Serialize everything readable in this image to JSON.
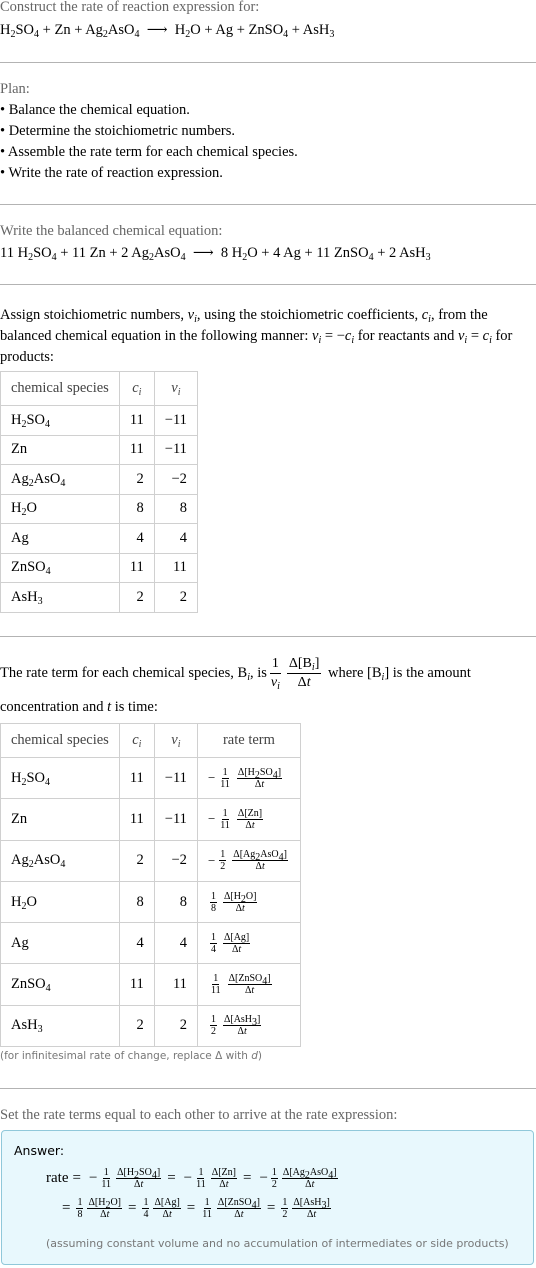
{
  "intro": {
    "prompt": "Construct the rate of reaction expression for:",
    "reaction": {
      "reactants": [
        "H2SO4",
        "Zn",
        "Ag2AsO4"
      ],
      "products": [
        "H2O",
        "Ag",
        "ZnSO4",
        "AsH3"
      ]
    }
  },
  "plan": {
    "title": "Plan:",
    "steps": [
      "• Balance the chemical equation.",
      "• Determine the stoichiometric numbers.",
      "• Assemble the rate term for each chemical species.",
      "• Write the rate of reaction expression."
    ]
  },
  "balanced": {
    "title": "Write the balanced chemical equation:",
    "equation": "11 H2SO4 + 11 Zn + 2 Ag2AsO4 ⟶ 8 H2O + 4 Ag + 11 ZnSO4 + 2 AsH3"
  },
  "stoich": {
    "text": "Assign stoichiometric numbers, νi, using the stoichiometric coefficients, ci, from the balanced chemical equation in the following manner: νi = −ci for reactants and νi = ci for products:",
    "headers": [
      "chemical species",
      "ci",
      "νi"
    ],
    "rows": [
      {
        "species": "H2SO4",
        "c": "11",
        "v": "−11"
      },
      {
        "species": "Zn",
        "c": "11",
        "v": "−11"
      },
      {
        "species": "Ag2AsO4",
        "c": "2",
        "v": "−2"
      },
      {
        "species": "H2O",
        "c": "8",
        "v": "8"
      },
      {
        "species": "Ag",
        "c": "4",
        "v": "4"
      },
      {
        "species": "ZnSO4",
        "c": "11",
        "v": "11"
      },
      {
        "species": "AsH3",
        "c": "2",
        "v": "2"
      }
    ]
  },
  "rateterm": {
    "text_a": "The rate term for each chemical species, Bi, is",
    "text_b": "where [Bi] is the amount concentration and t is time:",
    "headers": [
      "chemical species",
      "ci",
      "νi",
      "rate term"
    ],
    "rows": [
      {
        "species": "H2SO4",
        "c": "11",
        "v": "−11",
        "sign": "−",
        "den": "11",
        "num": "Δ[H2SO4]"
      },
      {
        "species": "Zn",
        "c": "11",
        "v": "−11",
        "sign": "−",
        "den": "11",
        "num": "Δ[Zn]"
      },
      {
        "species": "Ag2AsO4",
        "c": "2",
        "v": "−2",
        "sign": "−",
        "den": "2",
        "num": "Δ[Ag2AsO4]"
      },
      {
        "species": "H2O",
        "c": "8",
        "v": "8",
        "sign": "",
        "den": "8",
        "num": "Δ[H2O]"
      },
      {
        "species": "Ag",
        "c": "4",
        "v": "4",
        "sign": "",
        "den": "4",
        "num": "Δ[Ag]"
      },
      {
        "species": "ZnSO4",
        "c": "11",
        "v": "11",
        "sign": "",
        "den": "11",
        "num": "Δ[ZnSO4]"
      },
      {
        "species": "AsH3",
        "c": "2",
        "v": "2",
        "sign": "",
        "den": "2",
        "num": "Δ[AsH3]"
      }
    ],
    "note": "(for infinitesimal rate of change, replace Δ with d)"
  },
  "final": {
    "title": "Set the rate terms equal to each other to arrive at the rate expression:",
    "answer_label": "Answer:",
    "rate_label": "rate",
    "assumption": "(assuming constant volume and no accumulation of intermediates or side products)"
  },
  "colors": {
    "answer_bg": "#e8f8fd",
    "answer_border": "#90c8da",
    "divider": "#b3b3b3",
    "muted_text": "#666666"
  }
}
